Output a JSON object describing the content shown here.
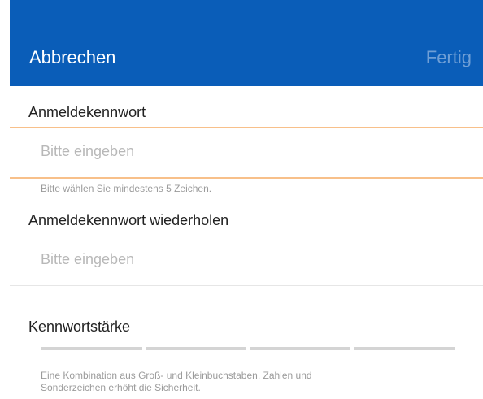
{
  "navbar": {
    "cancel_label": "Abbrechen",
    "done_label": "Fertig",
    "background": "#0a5db8",
    "done_color": "#6f9fd6"
  },
  "password": {
    "label": "Anmeldekennwort",
    "placeholder": "Bitte eingeben",
    "hint": "Bitte wählen Sie mindestens 5 Zeichen.",
    "underline_color": "#f8c08a"
  },
  "repeat_password": {
    "label": "Anmeldekennwort wiederholen",
    "placeholder": "Bitte eingeben"
  },
  "strength": {
    "label": "Kennwortstärke",
    "segment_count": 4,
    "filled_segments": 0,
    "hint_line1": "Eine Kombination aus Groß- und Kleinbuchstaben, Zahlen und",
    "hint_line2": "Sonderzeichen erhöht die Sicherheit."
  }
}
